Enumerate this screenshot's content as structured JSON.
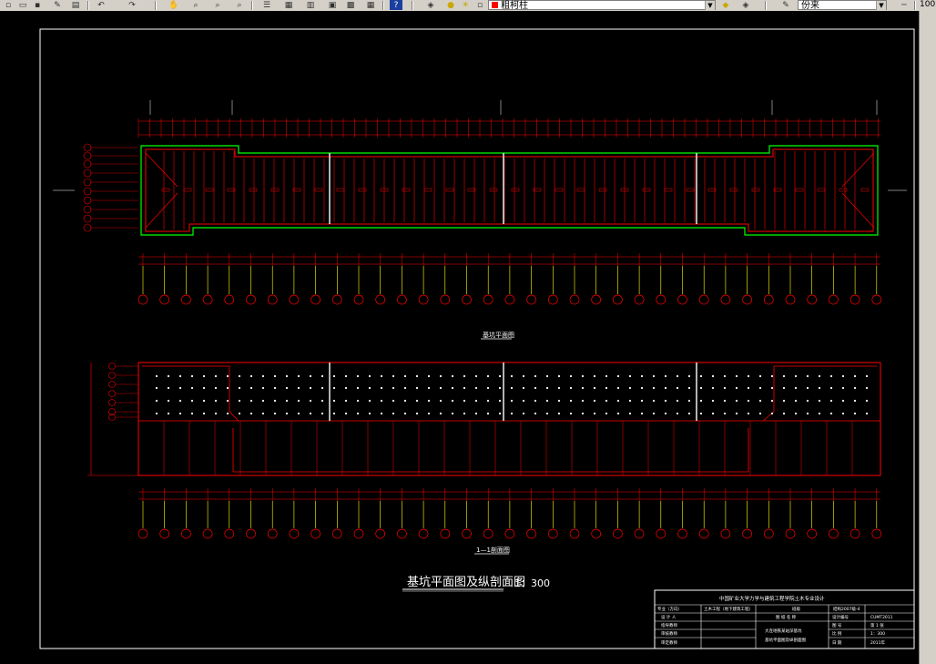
{
  "toolbar": {
    "layer_combo": "粗柯柱",
    "linetype_combo": "份来",
    "zoom_value": "100"
  },
  "drawing": {
    "plan_title": "基坑平面图",
    "section_title": "1—1剖面图",
    "main_title": "基坑平面图及纵剖面图",
    "scale": "1：300",
    "title_block": {
      "header": "中国矿业大学力学与建筑工程学院土木专业设计",
      "r1": [
        "专业（方向）",
        "土木工程（地下建筑工程）",
        "班级",
        "结构2007级-4"
      ],
      "r2": [
        "设 计 人",
        "图 纸 名 称",
        "设计编号",
        "CUMT2011"
      ],
      "r3": [
        "指导教师",
        "大连地铁某站深基坑",
        "图 号",
        "第 1 张"
      ],
      "r4": [
        "审核教师",
        "",
        "比 例",
        "1：300"
      ],
      "r5": [
        "审定教师",
        "基坑平面图及纵剖面图",
        "日 期",
        "2011年"
      ]
    },
    "colors": {
      "red": "#ff0000",
      "green": "#00ff00",
      "white": "#ffffff",
      "yellow": "#ffff00",
      "bg": "#000000"
    }
  }
}
